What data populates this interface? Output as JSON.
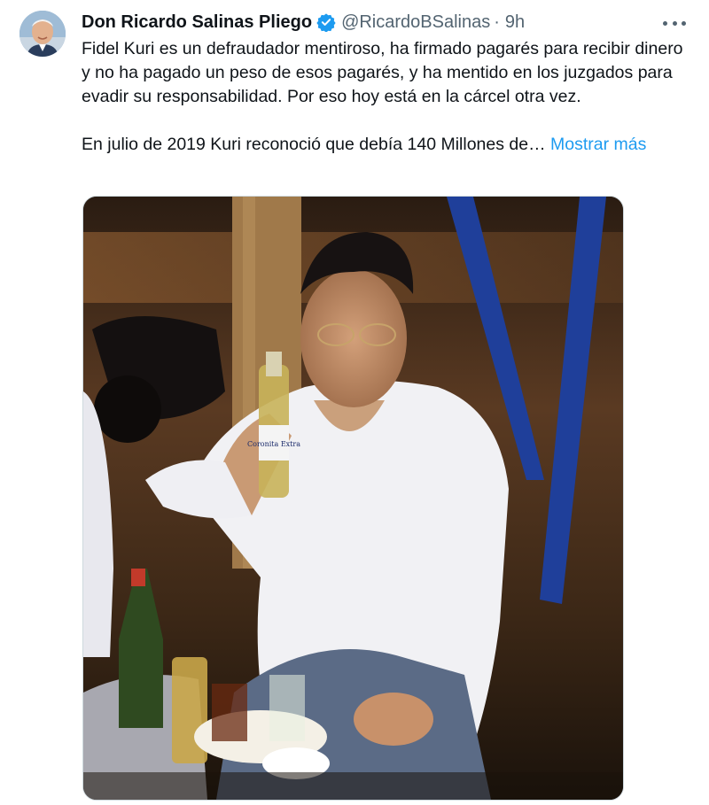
{
  "tweet": {
    "author": {
      "display_name": "Don Ricardo Salinas Pliego",
      "handle": "@RicardoBSalinas",
      "separator": "·",
      "time": "9h",
      "verified": true,
      "verified_color": "#1d9bf0"
    },
    "text": {
      "paragraph1": "Fidel Kuri es un defraudador mentiroso, ha firmado pagarés para recibir dinero y no ha pagado un peso de esos pagarés, y ha mentido en los juzgados para evadir su responsabilidad. Por eso hoy está en la cárcel otra vez.",
      "paragraph2": "En julio de 2019 Kuri reconoció que debía 140 Millones de…",
      "show_more": "Mostrar más"
    },
    "media": {
      "bottle_label": "Coronita Extra"
    },
    "icons": {
      "more": "more-horizontal-icon",
      "verified": "verified-badge-icon"
    },
    "colors": {
      "text": "#0f1419",
      "secondary": "#536471",
      "link": "#1d9bf0"
    }
  }
}
